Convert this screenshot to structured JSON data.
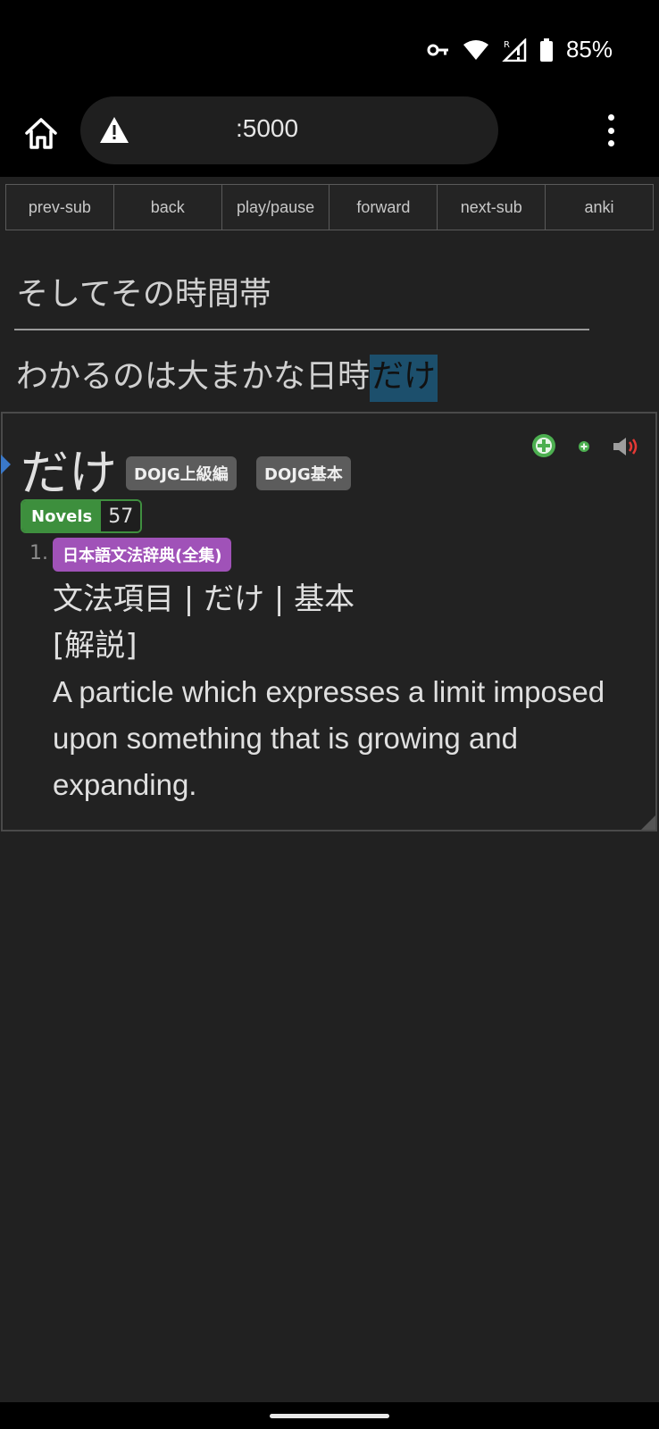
{
  "status": {
    "battery_pct": "85%",
    "icons": [
      "vpn-key-icon",
      "wifi-icon",
      "cell-signal-roaming-icon",
      "battery-icon"
    ]
  },
  "browser": {
    "url": ":5000",
    "icons": [
      "home-icon",
      "warning-icon",
      "more-vert-icon"
    ]
  },
  "toolbar": {
    "buttons": [
      "prev-sub",
      "back",
      "play/pause",
      "forward",
      "next-sub",
      "anki"
    ]
  },
  "subtitles": {
    "line1": "そしてその時間帯",
    "line2_before": "わかるのは大まかな日時",
    "line2_highlight": "だけ"
  },
  "popup": {
    "headword": "だけ",
    "tags": [
      "DOJG上級編",
      "DOJG基本"
    ],
    "frequency": {
      "label": "Novels",
      "value": "57"
    },
    "definition": {
      "number": "1.",
      "dictionary": "日本語文法辞典(全集)",
      "line1": "文法項目 | だけ | 基本",
      "line2": "[解説]",
      "line3": "A particle which expresses a limit imposed upon something that is growing and expanding."
    },
    "colors": {
      "add": "#4caf50",
      "audio": "#e53935",
      "dict_tag": "#a052b8",
      "freq": "#3d8f3d",
      "highlight": "#1c4f6c"
    }
  }
}
